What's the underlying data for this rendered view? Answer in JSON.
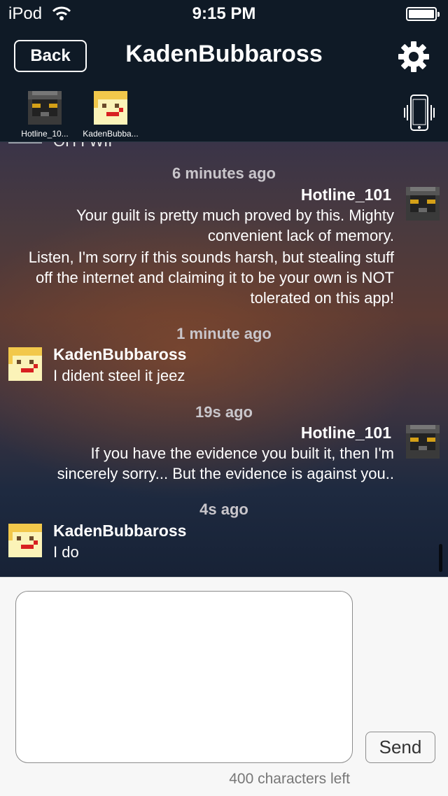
{
  "status_bar": {
    "carrier": "iPod",
    "time": "9:15 PM"
  },
  "nav": {
    "back_label": "Back",
    "title": "KadenBubbaross",
    "settings_icon": "gear-icon"
  },
  "participants": [
    {
      "name": "Hotline_10...",
      "avatar": "dark-pixel-avatar"
    },
    {
      "name": "KadenBubba...",
      "avatar": "yellow-pixel-avatar"
    }
  ],
  "chat": {
    "partial_top_text": "OH I WII",
    "groups": [
      {
        "time": "6 minutes ago",
        "sender": "Hotline_101",
        "messages": [
          "Your guilt is pretty much proved by this. Mighty convenient lack of memory.",
          "Listen, I'm sorry if this sounds harsh, but stealing stuff off the internet and claiming it to be your own is NOT tolerated on this app!"
        ]
      },
      {
        "time": "1 minute ago",
        "sender": "KadenBubbaross",
        "messages": [
          "I dident steel it jeez"
        ]
      },
      {
        "time": "19s ago",
        "sender": "Hotline_101",
        "messages": [
          "If you have the evidence you built it, then I'm sincerely sorry... But the evidence is against you.."
        ]
      },
      {
        "time": "4s ago",
        "sender": "KadenBubbaross",
        "messages": [
          "I do"
        ]
      }
    ]
  },
  "composer": {
    "message_value": "",
    "send_label": "Send",
    "char_count": "400 characters left"
  },
  "colors": {
    "header_bg": "#0f1a26",
    "text": "#ffffff",
    "timestamp": "#c9c6cb"
  }
}
